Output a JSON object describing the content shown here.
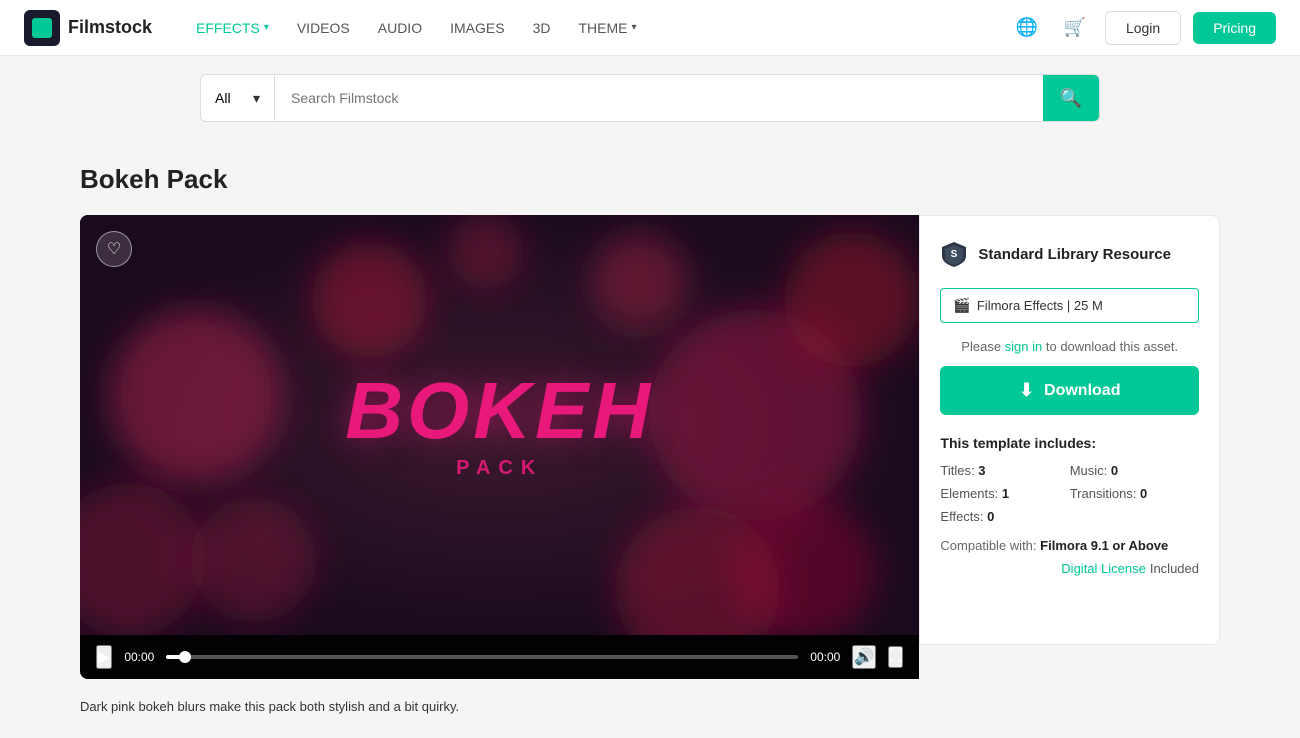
{
  "header": {
    "logo_text": "Filmstock",
    "nav": [
      {
        "label": "EFFECTS",
        "active": true,
        "has_chevron": true
      },
      {
        "label": "VIDEOS",
        "active": false,
        "has_chevron": false
      },
      {
        "label": "AUDIO",
        "active": false,
        "has_chevron": false
      },
      {
        "label": "IMAGES",
        "active": false,
        "has_chevron": false
      },
      {
        "label": "3D",
        "active": false,
        "has_chevron": false
      },
      {
        "label": "THEME",
        "active": false,
        "has_chevron": true
      }
    ],
    "login_label": "Login",
    "pricing_label": "Pricing"
  },
  "search": {
    "type_default": "All",
    "placeholder": "Search Filmstock"
  },
  "page": {
    "title": "Bokeh Pack"
  },
  "video": {
    "title_text": "BOKEH",
    "subtitle_text": "PACK",
    "time_current": "00:00",
    "time_total": "00:00"
  },
  "sidebar": {
    "resource_badge": "Standard Library Resource",
    "file_tag": "Filmora Effects | 25 M",
    "signin_note_pre": "Please ",
    "signin_link": "sign in",
    "signin_note_post": " to download this asset.",
    "download_label": "Download",
    "includes_title": "This template includes:",
    "titles_label": "Titles:",
    "titles_value": "3",
    "music_label": "Music:",
    "music_value": "0",
    "elements_label": "Elements:",
    "elements_value": "1",
    "transitions_label": "Transitions:",
    "transitions_value": "0",
    "effects_label": "Effects:",
    "effects_value": "0",
    "compat_pre": "Compatible with:",
    "compat_value": "Filmora 9.1 or Above",
    "license_link": "Digital License",
    "license_post": "Included"
  },
  "description": {
    "text": "Dark pink bokeh blurs make this pack both stylish and a bit quirky."
  }
}
